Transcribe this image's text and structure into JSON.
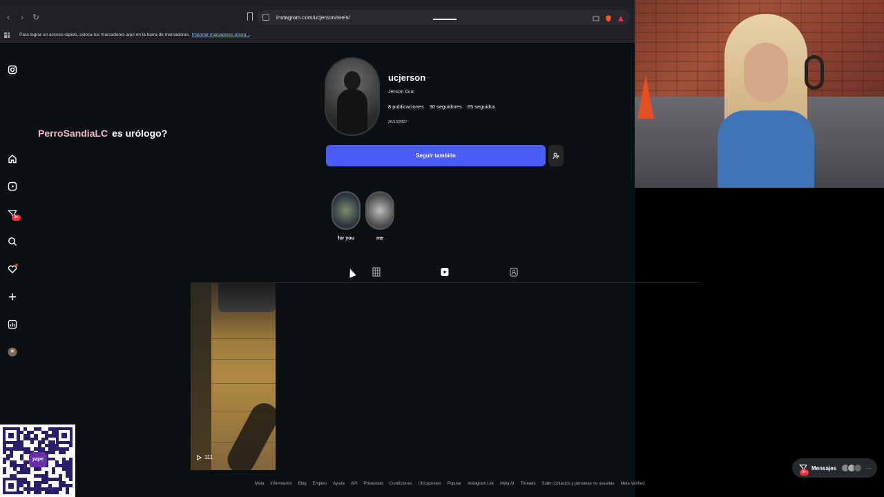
{
  "browser": {
    "url": "instagram.com/ucjerson/reels/",
    "bookmarks_hint": "Para lograr un acceso rápido, coloca tus marcadores aquí en la barra de marcadores.",
    "import_bookmarks_link": "Importar marcadores ahora..."
  },
  "sidebar": {
    "notifications_badge": "9+"
  },
  "overlay": {
    "username": "PerroSandiaLC",
    "message": "es urólogo?"
  },
  "profile": {
    "username": "ucjerson",
    "full_name": "Jerson Guc",
    "stats": {
      "posts": "8 publicaciones",
      "followers": "30 seguidores",
      "following": "65 seguidos"
    },
    "bio": "26/10/2007",
    "follow_button": "Seguir también"
  },
  "highlights": [
    {
      "label": "for you"
    },
    {
      "label": "me"
    }
  ],
  "reel": {
    "views": "111"
  },
  "footer": {
    "links": [
      "Meta",
      "Información",
      "Blog",
      "Empleo",
      "Ayuda",
      "API",
      "Privacidad",
      "Condiciones",
      "Ubicaciones",
      "Popular",
      "Instagram Lite",
      "Meta AI",
      "Threads",
      "Subir contactos y personas no usuarias",
      "Meta Verified"
    ]
  },
  "messages": {
    "label": "Mensajes",
    "badge": "9+"
  },
  "qr": {
    "logo_text": "yape"
  },
  "colors": {
    "follow_button": "#4a5df9",
    "badge": "#ff3040",
    "ig_background": "#0b1014"
  }
}
